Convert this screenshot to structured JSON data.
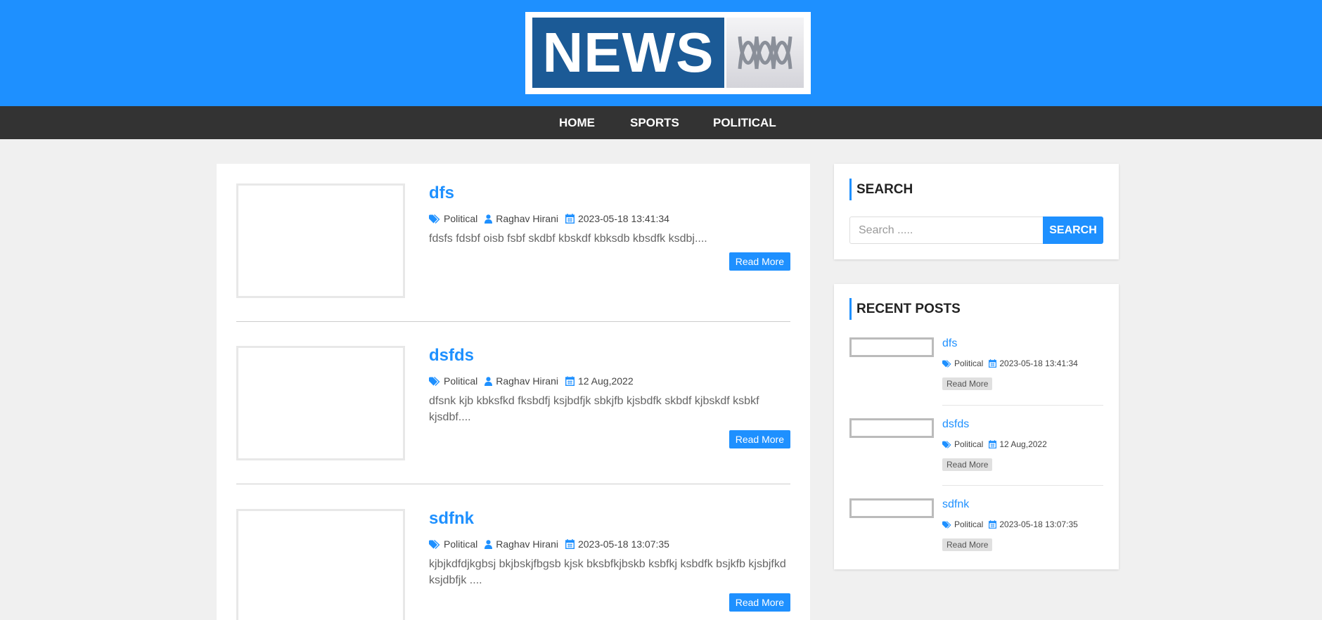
{
  "logo": {
    "text": "NEWS"
  },
  "nav": {
    "items": [
      "HOME",
      "SPORTS",
      "POLITICAL"
    ]
  },
  "posts": [
    {
      "title": "dfs",
      "category": "Political",
      "author": "Raghav Hirani",
      "date": "2023-05-18 13:41:34",
      "excerpt": "fdsfs fdsbf oisb fsbf skdbf kbskdf kbksdb kbsdfk ksdbj....",
      "read_more": "Read More"
    },
    {
      "title": "dsfds",
      "category": "Political",
      "author": "Raghav Hirani",
      "date": "12 Aug,2022",
      "excerpt": "dfsnk kjb kbksfkd fksbdfj ksjbdfjk sbkjfb kjsbdfk skbdf kjbskdf ksbkf kjsdbf....",
      "read_more": "Read More"
    },
    {
      "title": "sdfnk",
      "category": "Political",
      "author": "Raghav Hirani",
      "date": "2023-05-18 13:07:35",
      "excerpt": "kjbjkdfdjkgbsj bkjbskjfbgsb kjsk bksbfkjbskb ksbfkj ksbdfk bsjkfb kjsbjfkd ksjdbfjk ....",
      "read_more": "Read More"
    }
  ],
  "sidebar": {
    "search": {
      "title": "SEARCH",
      "placeholder": "Search .....",
      "button": "SEARCH"
    },
    "recent": {
      "title": "RECENT POSTS",
      "items": [
        {
          "title": "dfs",
          "category": "Political",
          "date": "2023-05-18 13:41:34",
          "read_more": "Read More"
        },
        {
          "title": "dsfds",
          "category": "Political",
          "date": "12 Aug,2022",
          "read_more": "Read More"
        },
        {
          "title": "sdfnk",
          "category": "Political",
          "date": "2023-05-18 13:07:35",
          "read_more": "Read More"
        }
      ]
    }
  },
  "colors": {
    "brand": "#1e90ff",
    "navbar": "#333333",
    "logo_panel": "#1b5a96"
  },
  "icons": {
    "category": "tags-icon",
    "author": "user-icon",
    "date": "calendar-icon"
  }
}
